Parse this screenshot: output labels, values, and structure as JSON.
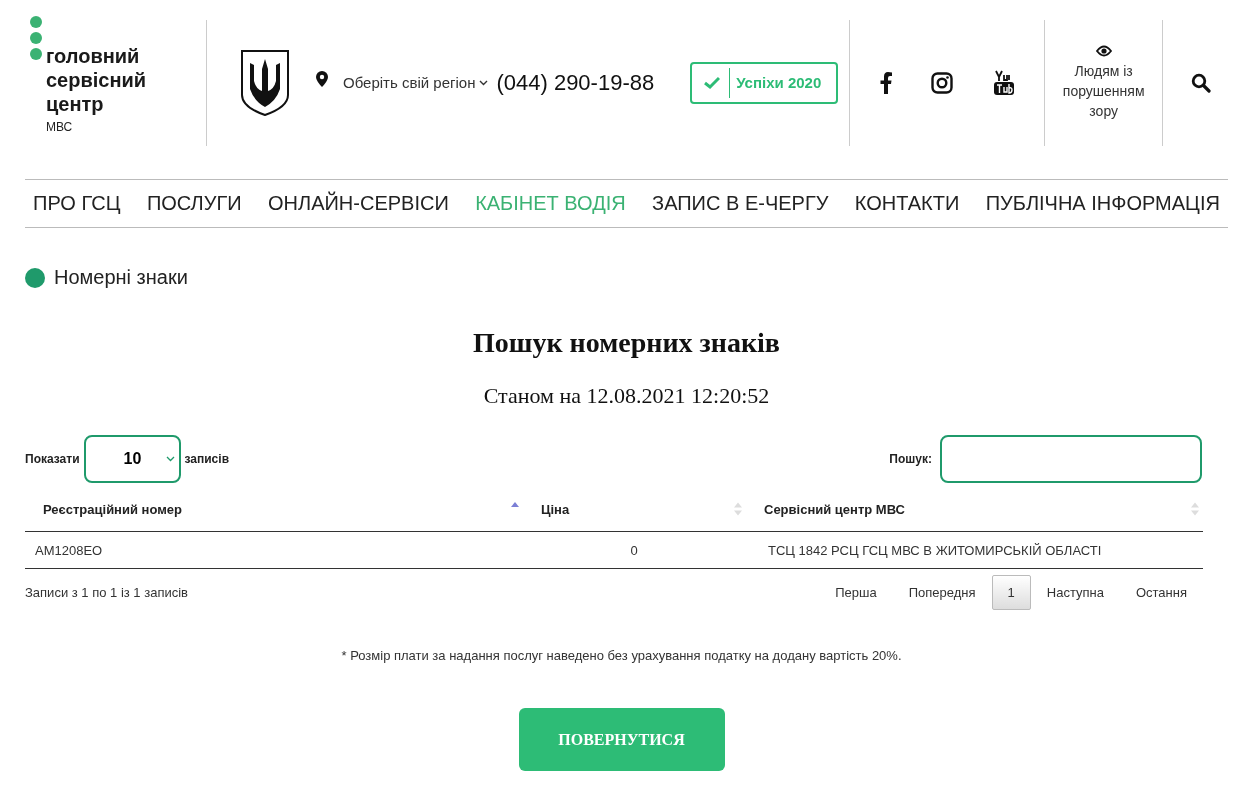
{
  "logo": {
    "lines": [
      "головний",
      "сервісний",
      "центр"
    ],
    "sub": "МВС"
  },
  "region": {
    "label": "Оберіть свій регіон",
    "phone": "(044) 290-19-88"
  },
  "success_button": "Успіхи 2020",
  "accessibility": "Людям із порушенням зору",
  "nav": [
    {
      "label": "ПРО ГСЦ",
      "selected": false
    },
    {
      "label": "ПОСЛУГИ",
      "selected": false
    },
    {
      "label": "ОНЛАЙН-СЕРВІСИ",
      "selected": false
    },
    {
      "label": "КАБІНЕТ ВОДІЯ",
      "selected": true
    },
    {
      "label": "ЗАПИС В Е-ЧЕРГУ",
      "selected": false
    },
    {
      "label": "КОНТАКТИ",
      "selected": false
    },
    {
      "label": "ПУБЛІЧНА ІНФОРМАЦІЯ",
      "selected": false
    }
  ],
  "breadcrumb": "Номерні знаки",
  "title": "Пошук номерних знаків",
  "subtitle": "Станом на 12.08.2021 12:20:52",
  "length": {
    "before": "Показати",
    "value": "10",
    "after": "записів"
  },
  "search": {
    "label": "Пошук:"
  },
  "table": {
    "columns": [
      {
        "label": "Реєстраційний номер",
        "sorted": true
      },
      {
        "label": "Ціна",
        "sorted": false
      },
      {
        "label": "Сервісний центр МВС",
        "sorted": false
      }
    ],
    "rows": [
      [
        "AM1208EO",
        "0",
        "ТСЦ 1842 РСЦ ГСЦ МВС В ЖИТОМИРСЬКІЙ ОБЛАСТІ"
      ]
    ]
  },
  "info": "Записи з 1 по 1 із 1 записів",
  "pagination": [
    {
      "label": "Перша",
      "selected": false
    },
    {
      "label": "Попередня",
      "selected": false
    },
    {
      "label": "1",
      "selected": true
    },
    {
      "label": "Наступна",
      "selected": false
    },
    {
      "label": "Остання",
      "selected": false
    }
  ],
  "note": "* Розмір плати за надання послуг наведено без урахування податку на додану вартість 20%.",
  "back_button": "ПОВЕРНУТИСЯ"
}
